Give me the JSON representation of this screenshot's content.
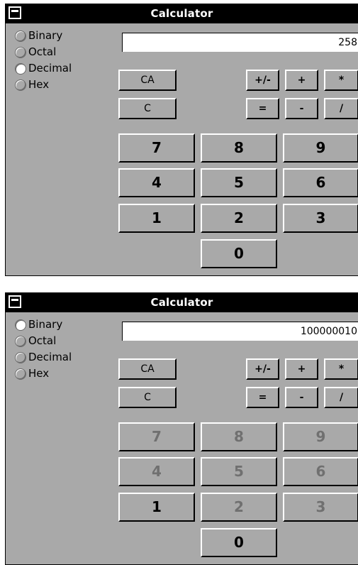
{
  "windows": [
    {
      "title": "Calculator",
      "radios": [
        {
          "label": "Binary",
          "selected": false
        },
        {
          "label": "Octal",
          "selected": false
        },
        {
          "label": "Decimal",
          "selected": true
        },
        {
          "label": "Hex",
          "selected": false
        }
      ],
      "display": "258",
      "buttons": {
        "ca": "CA",
        "c": "C",
        "plus_minus": "+/-",
        "plus": "+",
        "multiply": "*",
        "equals": "=",
        "minus": "-",
        "divide": "/",
        "d7": "7",
        "d8": "8",
        "d9": "9",
        "d4": "4",
        "d5": "5",
        "d6": "6",
        "d1": "1",
        "d2": "2",
        "d3": "3",
        "d0": "0"
      },
      "disabled_digits": []
    },
    {
      "title": "Calculator",
      "radios": [
        {
          "label": "Binary",
          "selected": true
        },
        {
          "label": "Octal",
          "selected": false
        },
        {
          "label": "Decimal",
          "selected": false
        },
        {
          "label": "Hex",
          "selected": false
        }
      ],
      "display": "100000010",
      "buttons": {
        "ca": "CA",
        "c": "C",
        "plus_minus": "+/-",
        "plus": "+",
        "multiply": "*",
        "equals": "=",
        "minus": "-",
        "divide": "/",
        "d7": "7",
        "d8": "8",
        "d9": "9",
        "d4": "4",
        "d5": "5",
        "d6": "6",
        "d1": "1",
        "d2": "2",
        "d3": "3",
        "d0": "0"
      },
      "disabled_digits": [
        "2",
        "3",
        "4",
        "5",
        "6",
        "7",
        "8",
        "9"
      ]
    }
  ]
}
